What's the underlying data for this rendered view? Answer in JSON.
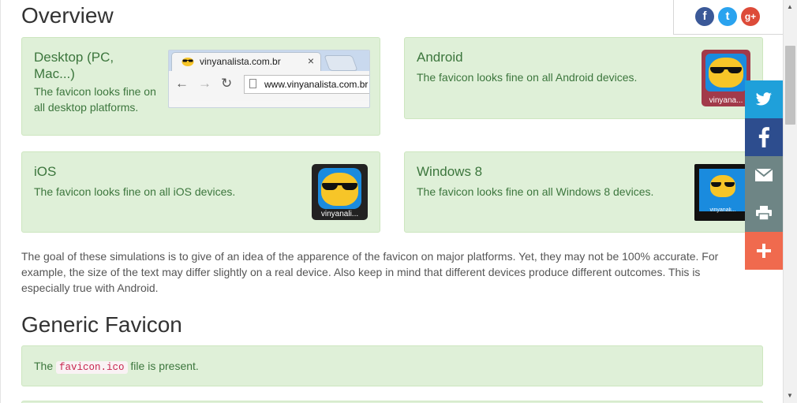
{
  "headings": {
    "overview": "Overview",
    "generic": "Generic Favicon"
  },
  "desktop": {
    "title": "Desktop (PC, Mac...)",
    "text": "The favicon looks fine on all desktop platforms.",
    "browser": {
      "tab_title": "vinyanalista.com.br",
      "tab_close": "×",
      "url": "www.vinyanalista.com.br"
    }
  },
  "android": {
    "title": "Android",
    "text": "The favicon looks fine on all Android devices.",
    "icon_label": "vinyana..."
  },
  "ios": {
    "title": "iOS",
    "text": "The favicon looks fine on all iOS devices.",
    "icon_label": "vinyanali..."
  },
  "windows": {
    "title": "Windows 8",
    "text": "The favicon looks fine on all Windows 8 devices.",
    "icon_label": "vinyanali..."
  },
  "description": "The goal of these simulations is to give of an idea of the apparence of the favicon on major platforms. Yet, they may not be 100% accurate. For example, the size of the text may differ slightly on a real device. Also keep in mind that different devices produce different outcomes. This is especially true with Android.",
  "generic": {
    "prefix": "The",
    "code": "favicon.ico",
    "suffix": "file is present."
  },
  "share_top": [
    {
      "icon": "facebook-icon",
      "glyph": "f",
      "color": "#3b5998"
    },
    {
      "icon": "twitter-icon",
      "glyph": "t",
      "color": "#2aa3ef"
    },
    {
      "icon": "google-plus-icon",
      "glyph": "g+",
      "color": "#dd4b39"
    }
  ],
  "sharebar": [
    {
      "icon": "twitter-icon",
      "color": "#1fa0da"
    },
    {
      "icon": "facebook-icon",
      "color": "#2d4d8e"
    },
    {
      "icon": "email-icon",
      "color": "#6e8585"
    },
    {
      "icon": "print-icon",
      "color": "#6e8585"
    },
    {
      "icon": "plus-icon",
      "color": "#f06a4e"
    }
  ],
  "colors": {
    "panel": "#dff0d8",
    "panel_text": "#3c763d",
    "favicon_yellow": "#f7c528",
    "icon_blue": "#1a8bde"
  }
}
